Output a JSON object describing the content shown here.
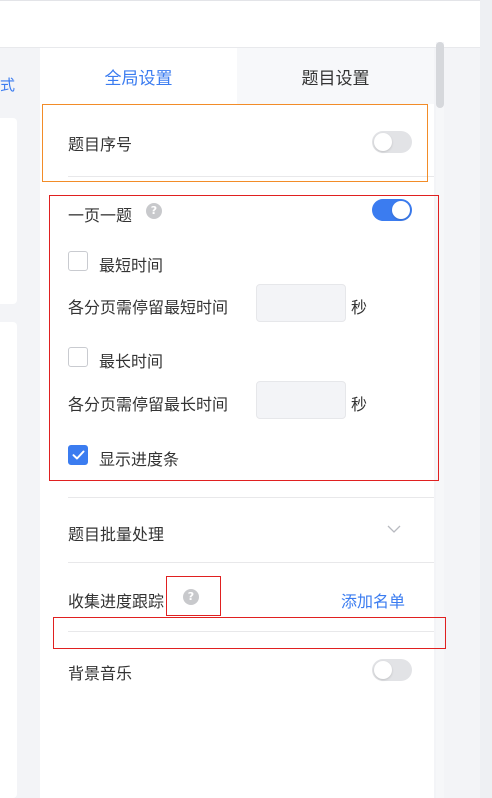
{
  "left": {
    "partial_label": "式"
  },
  "tabs": [
    {
      "label": "全局设置",
      "active": true
    },
    {
      "label": "题目设置",
      "active": false
    }
  ],
  "settings": {
    "question_number": {
      "label": "题目序号",
      "enabled": false
    },
    "one_per_page": {
      "label": "一页一题",
      "enabled": true,
      "help": "?"
    },
    "min_time": {
      "label": "最短时间",
      "checked": false,
      "desc": "各分页需停留最短时间",
      "unit": "秒",
      "value": ""
    },
    "max_time": {
      "label": "最长时间",
      "checked": false,
      "desc": "各分页需停留最长时间",
      "unit": "秒",
      "value": ""
    },
    "progress_bar": {
      "label": "显示进度条",
      "checked": true
    },
    "batch_process": {
      "label": "题目批量处理"
    },
    "collect_progress": {
      "label": "收集进度跟踪",
      "help": "?",
      "action": "添加名单"
    },
    "bg_music": {
      "label": "背景音乐",
      "enabled": false
    }
  },
  "colors": {
    "accent": "#3b7cf0",
    "highlight_orange": "#f28c28",
    "highlight_red": "#e02020"
  }
}
